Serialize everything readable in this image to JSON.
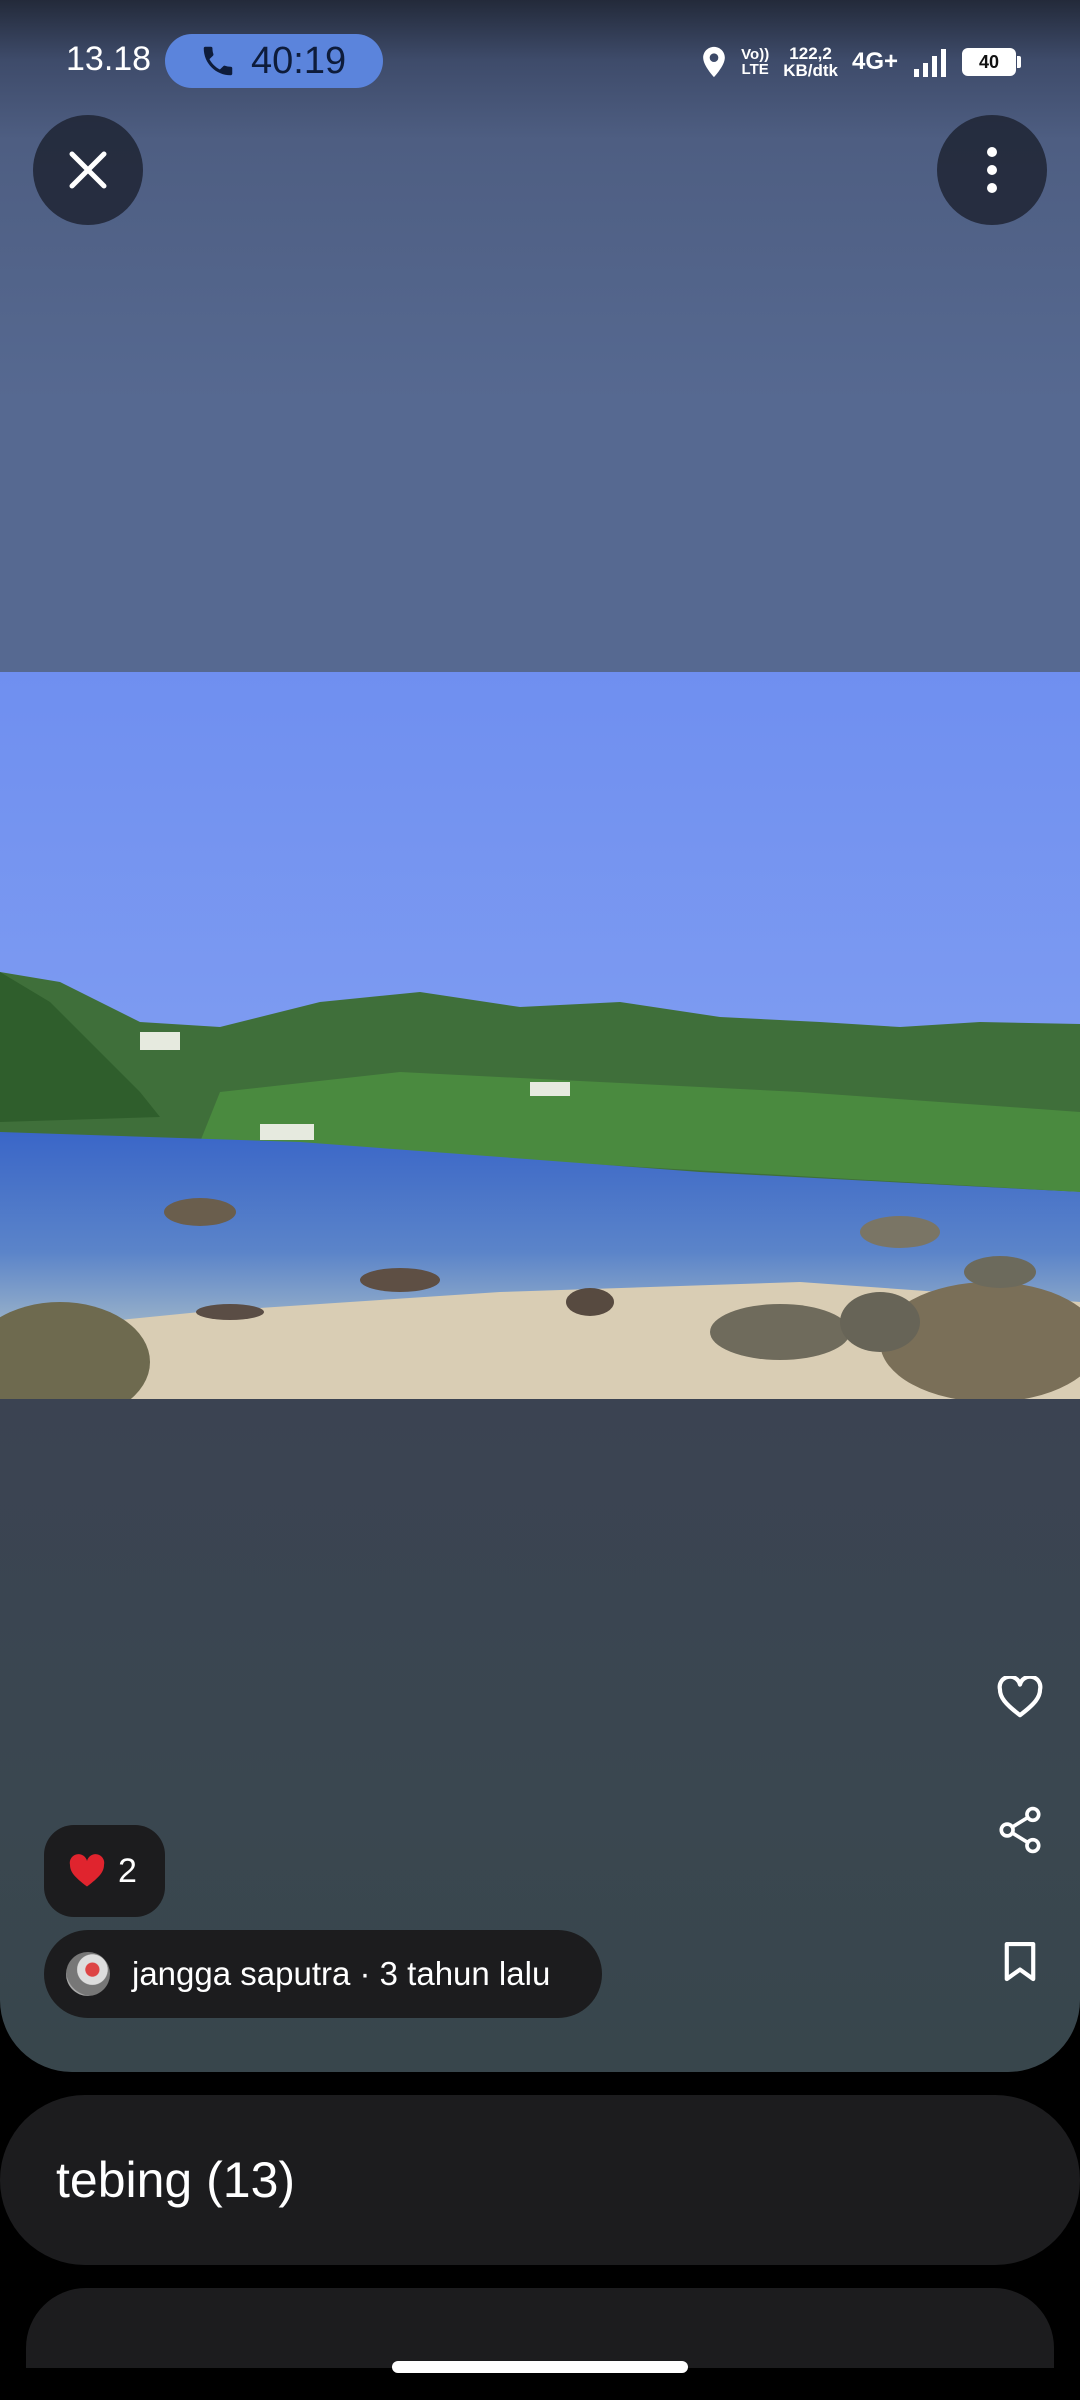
{
  "status_bar": {
    "time": "13.18",
    "call_timer": "40:19",
    "volte_line1": "Vo))",
    "volte_line2": "LTE",
    "speed_line1": "122,2",
    "speed_line2": "KB/dtk",
    "network": "4G+",
    "battery": "40",
    "icons": [
      "phone-icon",
      "location-icon",
      "signal-icon",
      "battery-icon"
    ]
  },
  "toolbar": {
    "icons": [
      "close-icon",
      "more-vert-icon"
    ]
  },
  "actions": {
    "icons": [
      "heart-outline-icon",
      "share-icon",
      "bookmark-icon"
    ]
  },
  "reaction": {
    "emoji": "heart-emoji",
    "count": "2"
  },
  "author": {
    "meta": "jangga saputra · 3 tahun lalu"
  },
  "album": {
    "label": "tebing (13)"
  },
  "colors": {
    "call_chip": "#5b84dc",
    "card_bg": "#1c1c1e",
    "reaction_heart": "#e0242e"
  }
}
